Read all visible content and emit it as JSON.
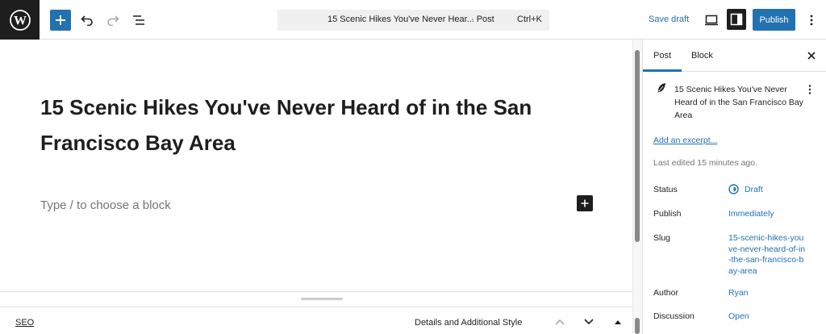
{
  "header": {
    "document_title": "15 Scenic Hikes You've Never Hear...",
    "document_type": "· Post",
    "shortcut": "Ctrl+K",
    "save_draft_label": "Save draft",
    "publish_label": "Publish"
  },
  "editor": {
    "post_title": "15 Scenic Hikes You've Never Heard of in the San Francisco Bay Area",
    "block_placeholder": "Type / to choose a block"
  },
  "metabox": {
    "seo_label": "SEO",
    "details_label": "Details and Additional Style"
  },
  "sidebar": {
    "tabs": [
      "Post",
      "Block"
    ],
    "post_summary_title": "15 Scenic Hikes You've Never Heard of in the San Francisco Bay Area",
    "excerpt_link": "Add an excerpt...",
    "last_edited": "Last edited 15 minutes ago.",
    "rows": [
      {
        "label": "Status",
        "value": "Draft"
      },
      {
        "label": "Publish",
        "value": "Immediately"
      },
      {
        "label": "Slug",
        "value": "15-scenic-hikes-youve-never-heard-of-in-the-san-francisco-bay-area"
      },
      {
        "label": "Author",
        "value": "Ryan"
      },
      {
        "label": "Discussion",
        "value": "Open"
      }
    ]
  },
  "colors": {
    "accent": "#2271b1",
    "dark": "#1e1e1e",
    "muted": "#757575"
  },
  "icons": [
    "wordpress-logo-icon",
    "plus-icon",
    "undo-icon",
    "redo-icon",
    "list-view-icon",
    "preview-icon",
    "settings-icon",
    "more-vertical-icon",
    "close-icon",
    "feather-icon",
    "draft-status-icon",
    "chevron-up-icon",
    "chevron-down-icon",
    "caret-up-icon"
  ]
}
